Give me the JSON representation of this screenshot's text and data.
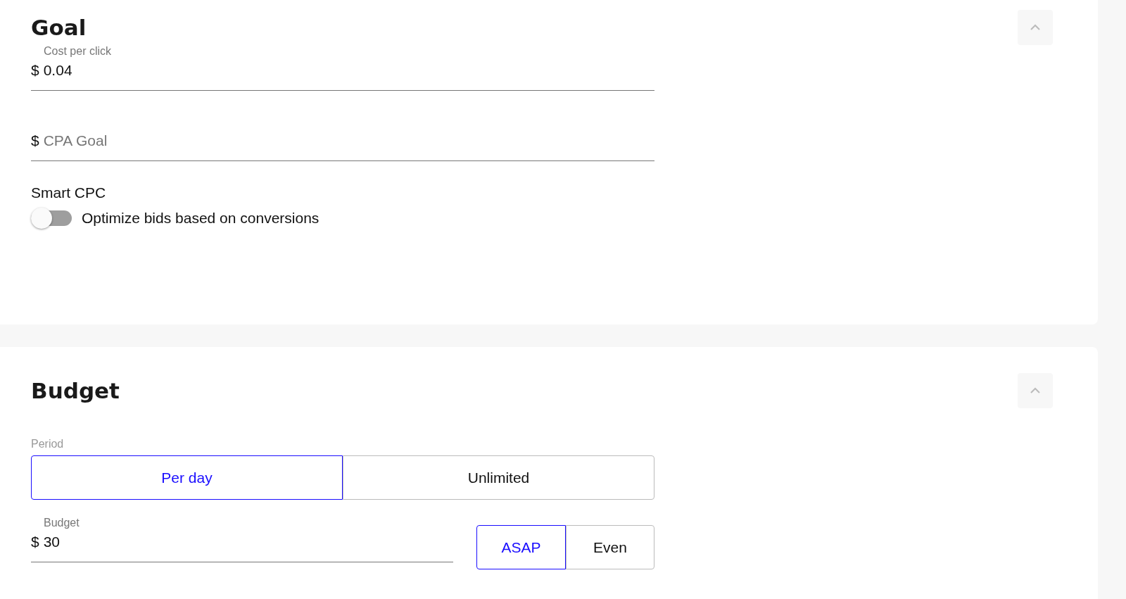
{
  "sections": [
    {
      "title": "Goal",
      "expanded": true,
      "content": [
        {
          "kind": "field",
          "label": "Cost per click",
          "prefix": "$",
          "value": "0.04"
        },
        {
          "kind": "field",
          "prefix": "$",
          "placeholder": "CPA Goal"
        },
        {
          "kind": "toggle",
          "label": "Smart CPC",
          "text": "Optimize bids based on conversions",
          "on": false
        }
      ]
    },
    {
      "title": "Budget",
      "expanded": true,
      "content": [
        {
          "kind": "segmented",
          "label": "Period",
          "options": [
            {
              "label": "Per day",
              "selected": true
            },
            {
              "label": "Unlimited",
              "selected": false
            }
          ]
        },
        {
          "kind": "field_with_segmented",
          "label": "Budget",
          "prefix": "$",
          "value": "30",
          "options": [
            {
              "label": "ASAP",
              "selected": true
            },
            {
              "label": "Even",
              "selected": false
            }
          ]
        }
      ]
    }
  ]
}
